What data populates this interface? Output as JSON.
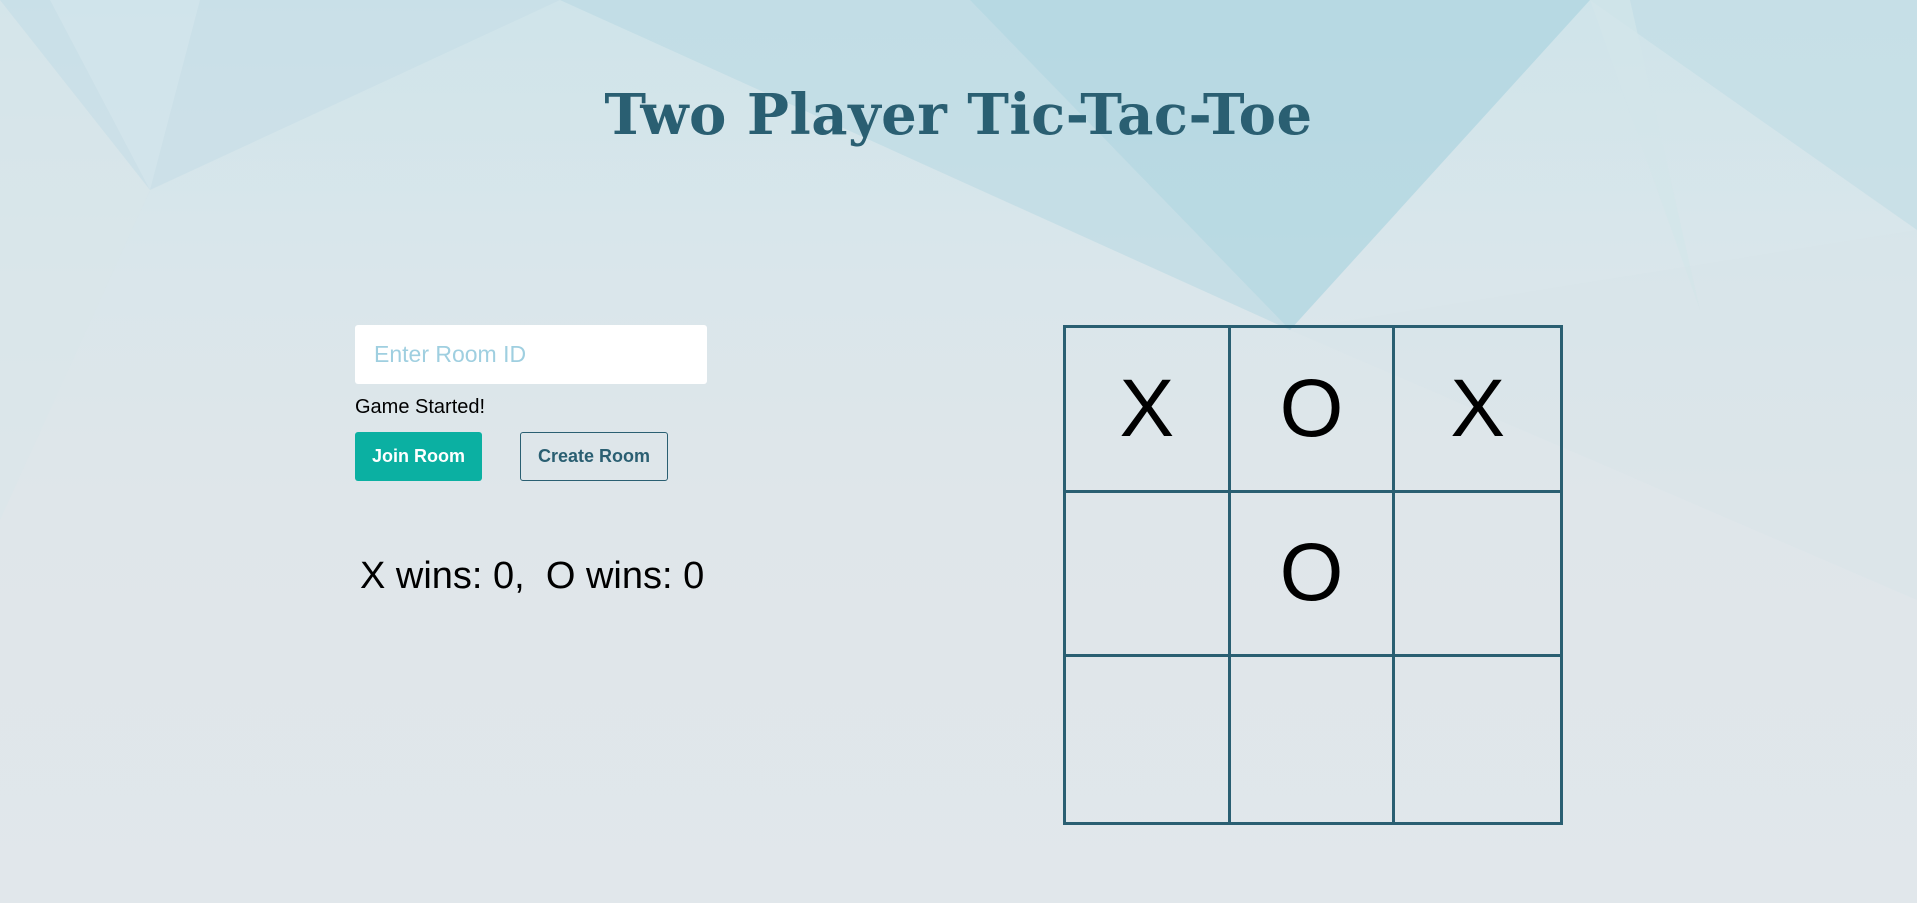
{
  "header": {
    "title": "Two Player Tic-Tac-Toe"
  },
  "room": {
    "input_value": "",
    "input_placeholder": "Enter Room ID",
    "status": "Game Started!",
    "join_label": "Join Room",
    "create_label": "Create Room"
  },
  "score": {
    "text": "X wins: 0,  O wins: 0",
    "x_wins": 0,
    "o_wins": 0
  },
  "board": {
    "cells": [
      "X",
      "O",
      "X",
      "",
      "O",
      "",
      "",
      "",
      ""
    ]
  },
  "colors": {
    "title": "#2a5f72",
    "accent": "#0bb0a2",
    "board_lines": "#2a5f72",
    "placeholder": "#9fcfe0"
  }
}
